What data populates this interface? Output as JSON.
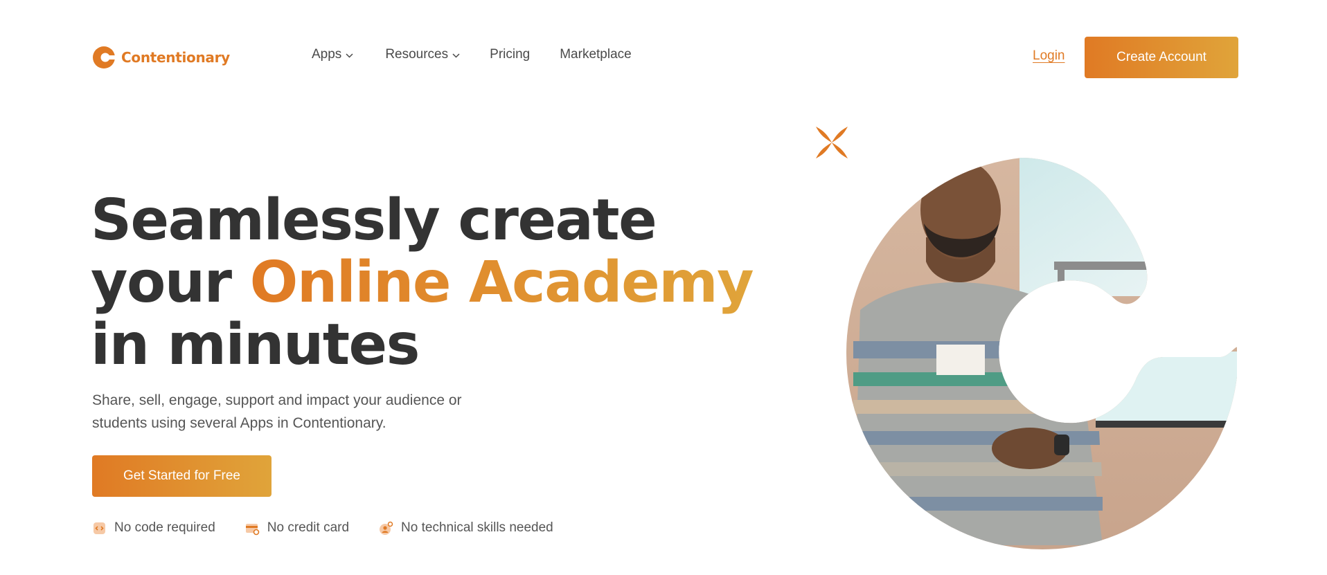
{
  "brand": {
    "name": "Contentionary",
    "logo_icon": "contentionary-logo-icon",
    "accent_color": "#e07a24",
    "accent_color_end": "#e0a43a",
    "text_color": "#333333"
  },
  "nav": {
    "items": [
      {
        "label": "Apps",
        "has_dropdown": true
      },
      {
        "label": "Resources",
        "has_dropdown": true
      },
      {
        "label": "Pricing",
        "has_dropdown": false
      },
      {
        "label": "Marketplace",
        "has_dropdown": false
      }
    ],
    "dropdown_icon": "chevron-down-icon"
  },
  "header": {
    "login_label": "Login",
    "create_account_label": "Create Account"
  },
  "hero": {
    "headline_line1": "Seamlessly create",
    "headline_line2_prefix": "your ",
    "headline_highlight": "Online Academy",
    "headline_line3": "in minutes",
    "subtext": "Share, sell, engage, support and impact your audience or students using several Apps in Contentionary.",
    "cta_label": "Get Started for Free",
    "features": [
      {
        "label": "No code required",
        "icon": "code-icon"
      },
      {
        "label": "No credit card",
        "icon": "credit-card-icon"
      },
      {
        "label": "No technical skills needed",
        "icon": "user-settings-icon"
      }
    ],
    "image": {
      "description_icon": "presenter-photo",
      "shape": "c-logo-mask"
    },
    "decoration_icon": "sparkle-icon"
  }
}
